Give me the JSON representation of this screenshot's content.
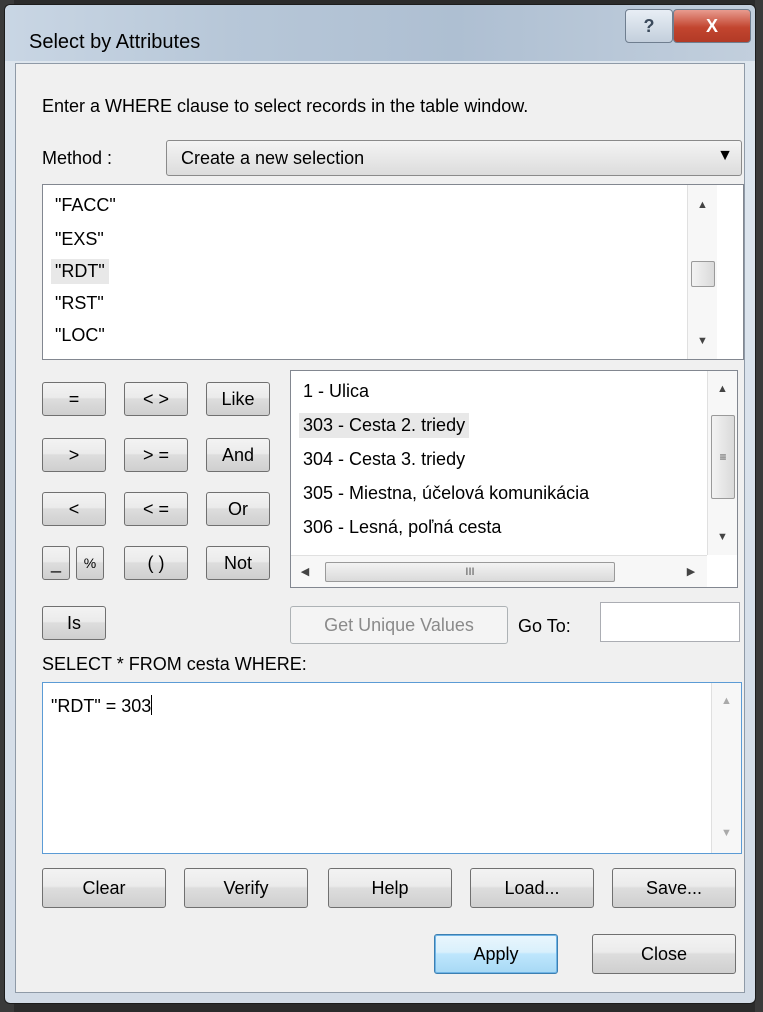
{
  "window": {
    "title": "Select by Attributes",
    "help_glyph": "?",
    "close_glyph": "X"
  },
  "instructions": "Enter a WHERE clause to select records in the table window.",
  "method": {
    "label": "Method :",
    "selected": "Create a new selection",
    "arrow": "▼"
  },
  "fields": [
    "\"FACC\"",
    "\"EXS\"",
    "\"RDT\"",
    "\"RST\"",
    "\"LOC\""
  ],
  "operators": {
    "eq": "=",
    "ne": "< >",
    "like": "Like",
    "gt": ">",
    "ge": "> =",
    "and": "And",
    "lt": "<",
    "le": "< =",
    "or": "Or",
    "underscore": "_",
    "percent": "%",
    "parens": "( )",
    "not": "Not",
    "is": "Is"
  },
  "values": [
    "1 - Ulica",
    "303 - Cesta 2. triedy",
    "304 - Cesta 3. triedy",
    "305 - Miestna, účelová komunikácia",
    "306 - Lesná, poľná cesta"
  ],
  "get_unique_values": "Get Unique Values",
  "goto_label": "Go To:",
  "goto_value": "",
  "sql_label": "SELECT * FROM cesta WHERE:",
  "sql_expression": "\"RDT\" = 303",
  "buttons": {
    "clear": "Clear",
    "verify": "Verify",
    "help": "Help",
    "load": "Load...",
    "save": "Save...",
    "apply": "Apply",
    "close": "Close"
  },
  "scroll_glyphs": {
    "up": "▲",
    "down": "▼",
    "left": "◀",
    "right": "▶",
    "grip": "≡",
    "hgrip": "III"
  }
}
